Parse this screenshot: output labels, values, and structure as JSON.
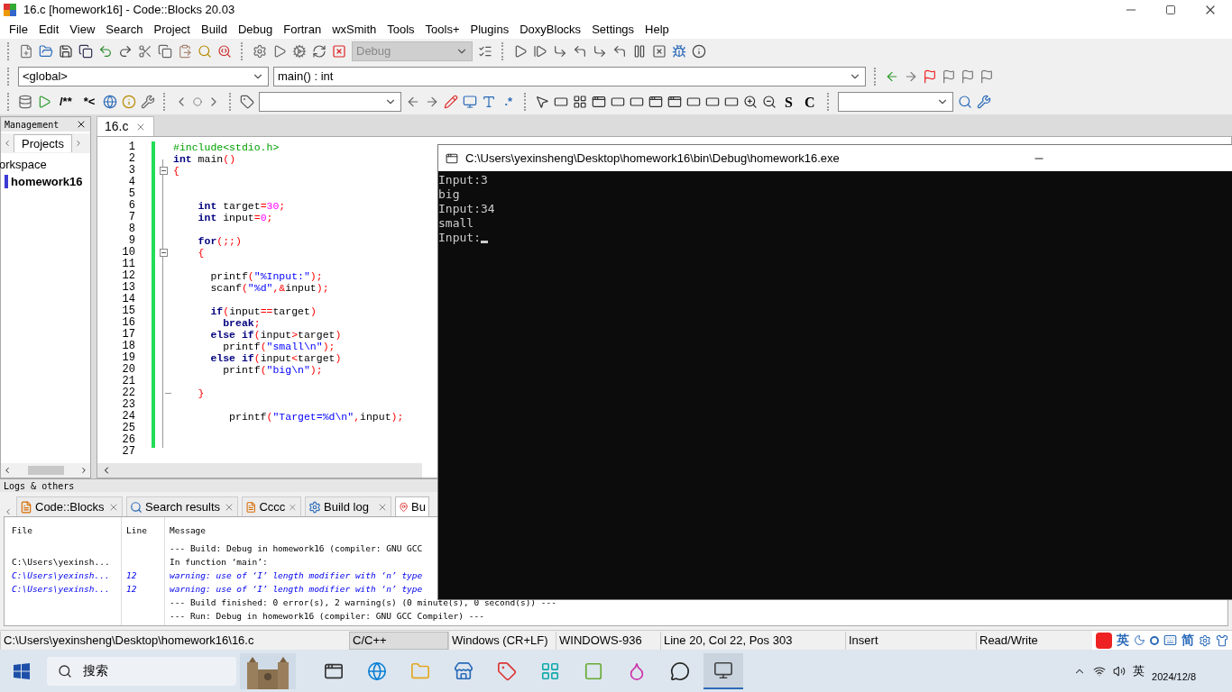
{
  "window": {
    "title": "16.c [homework16] - Code::Blocks 20.03"
  },
  "menu": [
    "File",
    "Edit",
    "View",
    "Search",
    "Project",
    "Build",
    "Debug",
    "Fortran",
    "wxSmith",
    "Tools",
    "Tools+",
    "Plugins",
    "DoxyBlocks",
    "Settings",
    "Help"
  ],
  "toolbars": {
    "build_target": {
      "value": "Debug",
      "disabled": true
    },
    "scope": "<global>",
    "function": "main() : int",
    "doc_buttons": [
      "/**",
      "*<"
    ],
    "regex_button": ".*",
    "text_buttons": [
      "S",
      "C"
    ]
  },
  "management": {
    "title": "Management",
    "tabs": [
      {
        "label": "Projects",
        "selected": true
      }
    ],
    "tree": [
      {
        "label": "orkspace",
        "children": [
          {
            "label": "homework16",
            "active": true
          }
        ]
      }
    ]
  },
  "editor": {
    "tabs": [
      {
        "label": "16.c",
        "selected": true
      }
    ],
    "lines": [
      {
        "num": "1",
        "segments": [
          {
            "kind": "pre",
            "text": "#include<stdio.h>"
          }
        ]
      },
      {
        "num": "2",
        "segments": [
          {
            "kind": "kw",
            "text": "int"
          },
          {
            "kind": "plain",
            "text": " main"
          },
          {
            "kind": "op",
            "text": "()"
          }
        ]
      },
      {
        "num": "3",
        "fold_start": true,
        "segments": [
          {
            "kind": "op",
            "text": "{"
          }
        ]
      },
      {
        "num": "4"
      },
      {
        "num": "5"
      },
      {
        "num": "6",
        "segments": [
          {
            "kind": "kw",
            "text": "    int"
          },
          {
            "kind": "plain",
            "text": " target"
          },
          {
            "kind": "op",
            "text": "="
          },
          {
            "kind": "num",
            "text": "30"
          },
          {
            "kind": "op",
            "text": ";"
          }
        ]
      },
      {
        "num": "7",
        "segments": [
          {
            "kind": "kw",
            "text": "    int"
          },
          {
            "kind": "plain",
            "text": " input"
          },
          {
            "kind": "op",
            "text": "="
          },
          {
            "kind": "num",
            "text": "0"
          },
          {
            "kind": "op",
            "text": ";"
          }
        ]
      },
      {
        "num": "8"
      },
      {
        "num": "9",
        "segments": [
          {
            "kind": "kw",
            "text": "    for"
          },
          {
            "kind": "op",
            "text": "(;;)"
          }
        ]
      },
      {
        "num": "10",
        "fold_start": true,
        "segments": [
          {
            "kind": "op",
            "text": "    {"
          }
        ]
      },
      {
        "num": "11"
      },
      {
        "num": "12",
        "segments": [
          {
            "kind": "plain",
            "text": "      printf"
          },
          {
            "kind": "op",
            "text": "("
          },
          {
            "kind": "str",
            "text": "\"%Input:\""
          },
          {
            "kind": "op",
            "text": ");"
          }
        ]
      },
      {
        "num": "13",
        "segments": [
          {
            "kind": "plain",
            "text": "      scanf"
          },
          {
            "kind": "op",
            "text": "("
          },
          {
            "kind": "str",
            "text": "\"%d\""
          },
          {
            "kind": "op",
            "text": ",&"
          },
          {
            "kind": "plain",
            "text": "input"
          },
          {
            "kind": "op",
            "text": ");"
          }
        ]
      },
      {
        "num": "14"
      },
      {
        "num": "15",
        "segments": [
          {
            "kind": "kw",
            "text": "      if"
          },
          {
            "kind": "op",
            "text": "("
          },
          {
            "kind": "plain",
            "text": "input"
          },
          {
            "kind": "op",
            "text": "=="
          },
          {
            "kind": "plain",
            "text": "target"
          },
          {
            "kind": "op",
            "text": ")"
          }
        ]
      },
      {
        "num": "16",
        "segments": [
          {
            "kind": "kw",
            "text": "        break"
          },
          {
            "kind": "op",
            "text": ";"
          }
        ]
      },
      {
        "num": "17",
        "segments": [
          {
            "kind": "kw",
            "text": "      else if"
          },
          {
            "kind": "op",
            "text": "("
          },
          {
            "kind": "plain",
            "text": "input"
          },
          {
            "kind": "op",
            "text": ">"
          },
          {
            "kind": "plain",
            "text": "target"
          },
          {
            "kind": "op",
            "text": ")"
          }
        ]
      },
      {
        "num": "18",
        "segments": [
          {
            "kind": "plain",
            "text": "        printf"
          },
          {
            "kind": "op",
            "text": "("
          },
          {
            "kind": "str",
            "text": "\"small\\n\""
          },
          {
            "kind": "op",
            "text": ");"
          }
        ]
      },
      {
        "num": "19",
        "segments": [
          {
            "kind": "kw",
            "text": "      else if"
          },
          {
            "kind": "op",
            "text": "("
          },
          {
            "kind": "plain",
            "text": "input"
          },
          {
            "kind": "op",
            "text": "<"
          },
          {
            "kind": "plain",
            "text": "target"
          },
          {
            "kind": "op",
            "text": ")"
          }
        ]
      },
      {
        "num": "20",
        "segments": [
          {
            "kind": "plain",
            "text": "        printf"
          },
          {
            "kind": "op",
            "text": "("
          },
          {
            "kind": "str",
            "text": "\"big\\n\""
          },
          {
            "kind": "op",
            "text": ");"
          }
        ]
      },
      {
        "num": "21"
      },
      {
        "num": "22",
        "fold_end": true,
        "segments": [
          {
            "kind": "op",
            "text": "    }"
          }
        ]
      },
      {
        "num": "23"
      },
      {
        "num": "24",
        "segments": [
          {
            "kind": "plain",
            "text": "         printf"
          },
          {
            "kind": "op",
            "text": "("
          },
          {
            "kind": "str",
            "text": "\"Target=%d\\n\""
          },
          {
            "kind": "op",
            "text": ","
          },
          {
            "kind": "plain",
            "text": "input"
          },
          {
            "kind": "op",
            "text": ");"
          }
        ]
      },
      {
        "num": "25"
      },
      {
        "num": "26"
      },
      {
        "num": "27"
      }
    ]
  },
  "logs": {
    "title": "Logs & others",
    "tabs": [
      {
        "label": "Code::Blocks",
        "selected": false
      },
      {
        "label": "Search results",
        "selected": false
      },
      {
        "label": "Cccc",
        "selected": false
      },
      {
        "label": "Build log",
        "selected": false
      },
      {
        "label": "Bu",
        "selected": true
      }
    ],
    "columns": [
      "File",
      "Line",
      "Message"
    ],
    "rows": [
      {
        "kind": "info",
        "message": "--- Build: Debug in homework16 (compiler: GNU GCC"
      },
      {
        "kind": "info",
        "file": "C:\\Users\\yexinsh...",
        "message": "In function ‘main’:"
      },
      {
        "kind": "warning",
        "file": "C:\\Users\\yexinsh...",
        "line": "12",
        "message": "warning: use of ‘I’ length modifier with ‘n’ type"
      },
      {
        "kind": "warning",
        "file": "C:\\Users\\yexinsh...",
        "line": "12",
        "message": "warning: use of ‘I’ length modifier with ‘n’ type"
      },
      {
        "kind": "info",
        "message": "--- Build finished: 0 error(s), 2 warning(s) (0 minute(s), 0 second(s)) ---"
      },
      {
        "kind": "info",
        "message": "--- Run: Debug in homework16 (compiler: GNU GCC Compiler) ---"
      }
    ]
  },
  "console": {
    "title": "C:\\Users\\yexinsheng\\Desktop\\homework16\\bin\\Debug\\homework16.exe",
    "lines": [
      "Input:3",
      "big",
      "Input:34",
      "small",
      "Input:"
    ]
  },
  "status_bar": [
    "C:\\Users\\yexinsheng\\Desktop\\homework16\\16.c",
    "C/C++",
    "Windows (CR+LF)",
    "WINDOWS-936",
    "Line 20, Col 22, Pos 303",
    "Insert",
    "Read/Write"
  ],
  "ime_toolbar": [
    "英",
    "简"
  ],
  "taskbar": {
    "search": "搜索",
    "tray_language": "英",
    "date": "2024/12/8"
  }
}
